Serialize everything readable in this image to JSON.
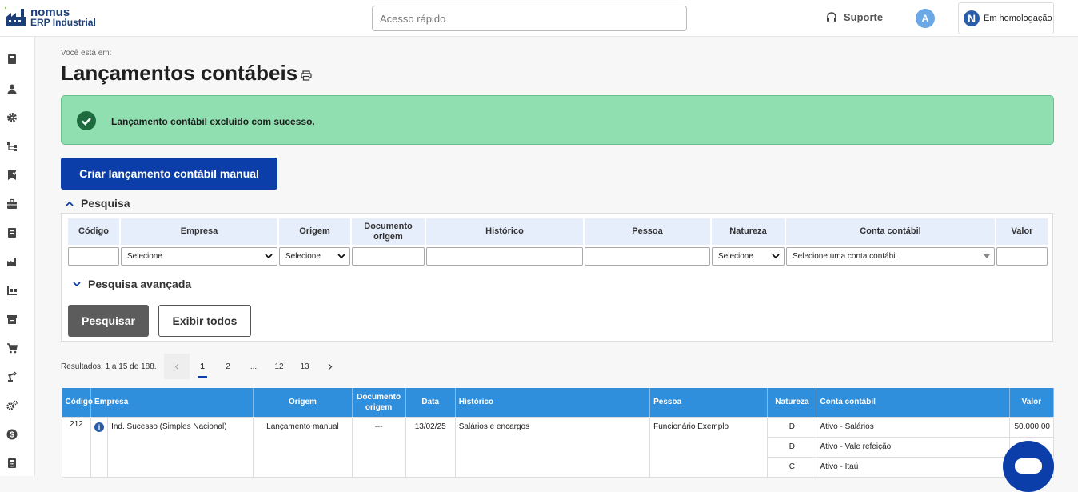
{
  "app": {
    "logo_line1": "nomus",
    "logo_line2": "ERP Industrial"
  },
  "header": {
    "quick_access_placeholder": "Acesso rápido",
    "support_label": "Suporte",
    "avatar_initial": "A",
    "environment_label": "Em homologação",
    "environment_badge": "N"
  },
  "sidebar": {
    "icons": [
      "book-icon",
      "user-icon",
      "gear-icon",
      "hierarchy-icon",
      "flag-icon",
      "briefcase-icon",
      "document-icon",
      "factory-icon",
      "forklift-icon",
      "archive-icon",
      "cart-icon",
      "robot-arm-icon",
      "gears-icon",
      "dollar-icon",
      "calculator-icon"
    ]
  },
  "page": {
    "breadcrumb": "Você está em:",
    "title": "Lançamentos contábeis"
  },
  "alert": {
    "message": "Lançamento contábil excluído com sucesso."
  },
  "actions": {
    "create_label": "Criar lançamento contábil manual"
  },
  "search": {
    "title": "Pesquisa",
    "columns": {
      "codigo": "Código",
      "empresa": "Empresa",
      "origem": "Origem",
      "documento": "Documento origem",
      "historico": "Histórico",
      "pessoa": "Pessoa",
      "natureza": "Natureza",
      "conta": "Conta contábil",
      "valor": "Valor"
    },
    "fields": {
      "codigo": "",
      "empresa": "Selecione",
      "origem": "Selecione",
      "documento": "",
      "historico": "",
      "pessoa": "",
      "natureza": "Selecione",
      "conta": "Selecione uma conta contábil",
      "valor": ""
    },
    "advanced_label": "Pesquisa avançada",
    "search_button": "Pesquisar",
    "show_all_button": "Exibir todos"
  },
  "pagination": {
    "results_text": "Resultados: 1 a 15 de 188.",
    "pages": [
      "1",
      "2",
      "...",
      "12",
      "13"
    ],
    "current": "1"
  },
  "table": {
    "headers": {
      "codigo": "Código",
      "empresa": "Empresa",
      "origem": "Origem",
      "documento": "Documento origem",
      "data": "Data",
      "historico": "Histórico",
      "pessoa": "Pessoa",
      "natureza": "Natureza",
      "conta": "Conta contábil",
      "valor": "Valor"
    },
    "row": {
      "codigo": "212",
      "empresa": "Ind. Sucesso (Simples Nacional)",
      "origem": "Lançamento manual",
      "documento": "---",
      "data": "13/02/25",
      "historico": "Salários e encargos",
      "pessoa": "Funcionário Exemplo",
      "entries": [
        {
          "natureza": "D",
          "conta": "Ativo - Salários",
          "valor": "50.000,00"
        },
        {
          "natureza": "D",
          "conta": "Ativo - Vale refeição",
          "valor": ""
        },
        {
          "natureza": "C",
          "conta": "Ativo - Itaú",
          "valor": ""
        }
      ]
    }
  },
  "colors": {
    "primary": "#0b3ea8",
    "table_header": "#2f8fdc",
    "success_bg": "#8fdfb0"
  }
}
